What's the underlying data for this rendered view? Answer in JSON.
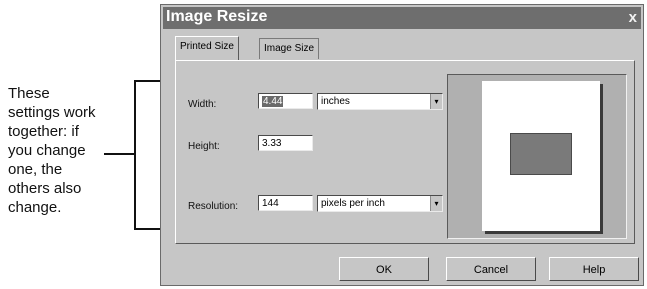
{
  "annotation": {
    "lines": [
      "These",
      "settings work",
      "together: if",
      "you change",
      "one, the",
      "others also",
      "change."
    ]
  },
  "dialog": {
    "title": "Image Resize",
    "close_glyph": "x",
    "tabs": [
      {
        "label": "Printed Size",
        "active": true
      },
      {
        "label": "Image Size",
        "active": false
      }
    ],
    "width": {
      "label": "Width:",
      "value": "4.44",
      "unit": "inches"
    },
    "height": {
      "label": "Height:",
      "value": "3.33"
    },
    "resolution": {
      "label": "Resolution:",
      "value": "144",
      "unit": "pixels per inch"
    },
    "buttons": {
      "ok": "OK",
      "cancel": "Cancel",
      "help": "Help"
    }
  }
}
